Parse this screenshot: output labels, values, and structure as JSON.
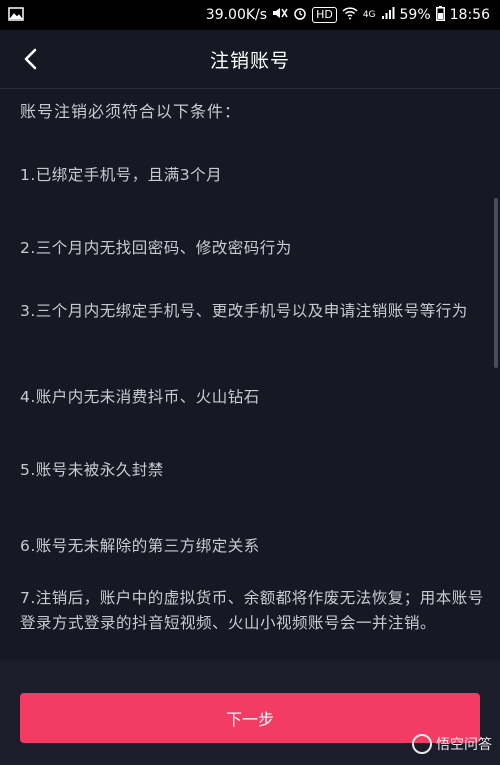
{
  "status_bar": {
    "speed": "39.00K/s",
    "hd": "HD",
    "network": "4G",
    "battery": "59%",
    "time": "18:56"
  },
  "header": {
    "title": "注销账号"
  },
  "content": {
    "intro": "账号注销必须符合以下条件：",
    "conditions": [
      "1.已绑定手机号，且满3个月",
      "2.三个月内无找回密码、修改密码行为",
      "3.三个月内无绑定手机号、更改手机号以及申请注销账号等行为",
      "4.账户内无未消费抖币、火山钻石",
      "5.账号未被永久封禁",
      "6.账号无未解除的第三方绑定关系",
      "7.注销后，账户中的虚拟货币、余额都将作废无法恢复；用本账号登录方式登录的抖音短视频、火山小视频账号会一并注销。"
    ]
  },
  "next_button": {
    "label": "下一步"
  },
  "watermark": {
    "text": "悟空问答"
  },
  "colors": {
    "background": "#161824",
    "accent": "#f33c63",
    "text": "#c9cad0"
  }
}
